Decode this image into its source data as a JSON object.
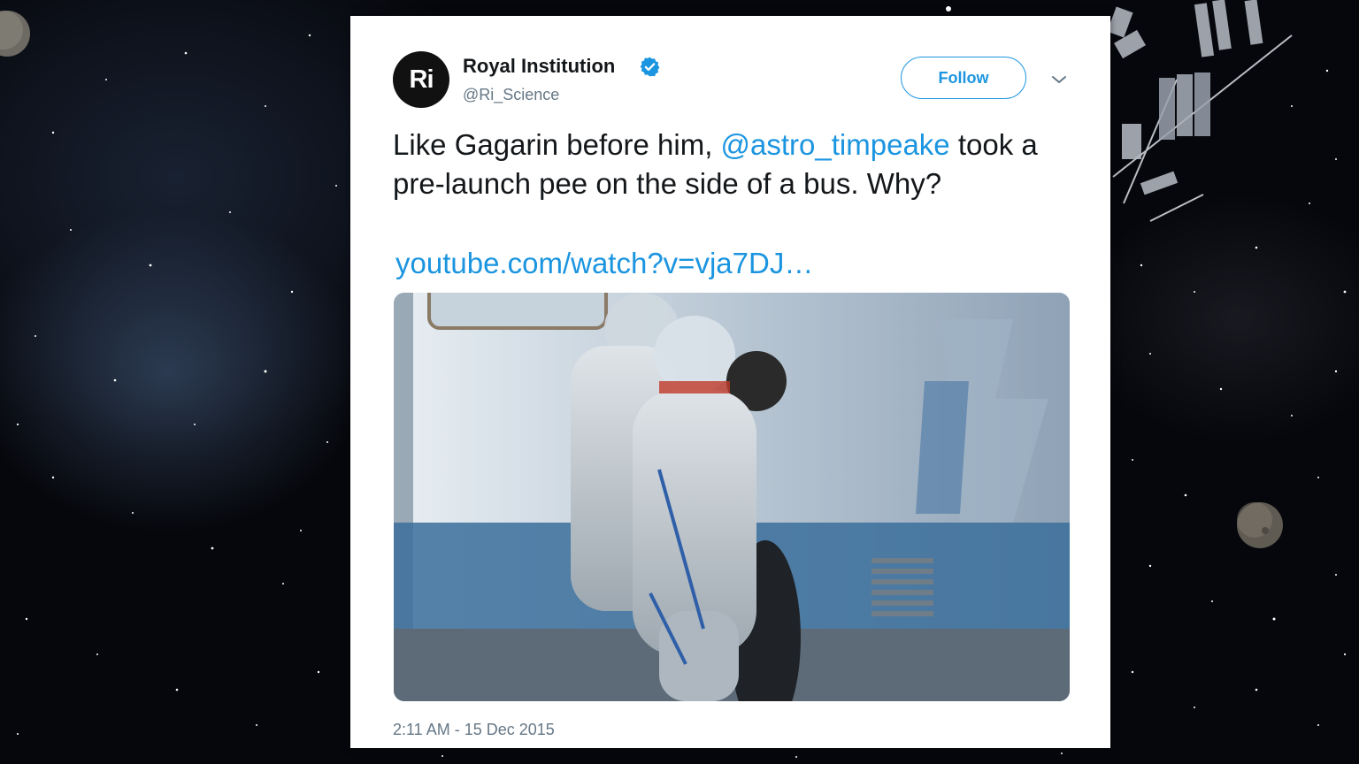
{
  "tweet": {
    "avatar_text": "Ri",
    "display_name": "Royal Institution",
    "handle": "@Ri_Science",
    "follow_label": "Follow",
    "text_part1": "Like Gagarin before him, ",
    "mention": "@astro_timpeake",
    "text_part2": " took a pre-launch pee on the side of a bus. Why?",
    "link": "youtube.com/watch?v=vja7DJ…",
    "timestamp": "2:11 AM - 15 Dec 2015"
  },
  "colors": {
    "accent": "#1b95e0",
    "text": "#14171a",
    "muted": "#657786",
    "background_space": "#06070c"
  },
  "icons": {
    "verified": "verified-badge-icon",
    "menu": "chevron-down-icon"
  }
}
